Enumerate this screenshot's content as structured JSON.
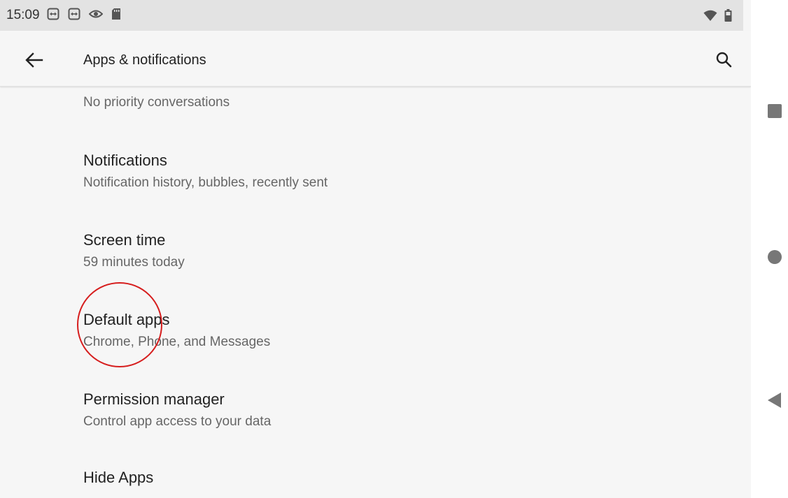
{
  "status_bar": {
    "time": "15:09",
    "left_icons": [
      "teamviewer-icon",
      "teamviewer-icon",
      "eye-icon",
      "sd-card-icon"
    ],
    "right_icons": [
      "wifi-icon",
      "battery-icon"
    ]
  },
  "app_bar": {
    "title": "Apps & notifications",
    "back_icon": "arrow-left-icon",
    "search_icon": "search-icon"
  },
  "list": {
    "partial_summary": "No priority conversations",
    "items": [
      {
        "title": "Notifications",
        "summary": "Notification history, bubbles, recently sent"
      },
      {
        "title": "Screen time",
        "summary": "59 minutes today"
      },
      {
        "title": "Default apps",
        "summary": "Chrome, Phone, and Messages"
      },
      {
        "title": "Permission manager",
        "summary": "Control app access to your data"
      },
      {
        "title": "Hide Apps",
        "summary": ""
      }
    ]
  },
  "annotation": {
    "color": "#d61e1e"
  },
  "navigation_bar": {
    "buttons": [
      "recents-square-icon",
      "home-circle-icon",
      "back-triangle-icon"
    ]
  },
  "colors": {
    "background": "#f6f6f6",
    "status_bar": "#e3e3e3",
    "primary_text": "#222222",
    "secondary_text": "#666666"
  }
}
